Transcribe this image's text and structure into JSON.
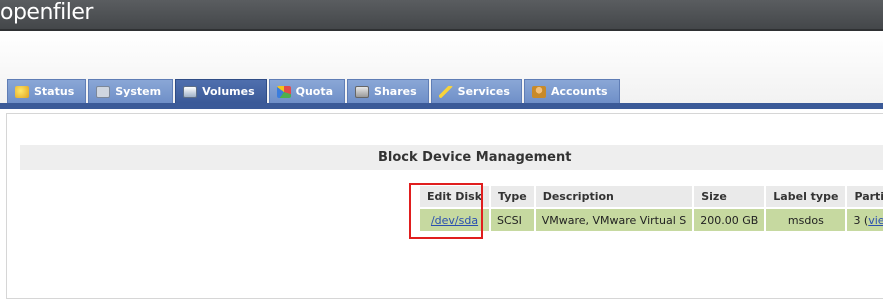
{
  "app": {
    "logo": "openfiler"
  },
  "tabs": [
    {
      "label": "Status",
      "icon": "status-icon",
      "active": false
    },
    {
      "label": "System",
      "icon": "system-icon",
      "active": false
    },
    {
      "label": "Volumes",
      "icon": "volumes-icon",
      "active": true
    },
    {
      "label": "Quota",
      "icon": "quota-icon",
      "active": false
    },
    {
      "label": "Shares",
      "icon": "shares-icon",
      "active": false
    },
    {
      "label": "Services",
      "icon": "services-icon",
      "active": false
    },
    {
      "label": "Accounts",
      "icon": "accounts-icon",
      "active": false
    }
  ],
  "section": {
    "title": "Block Device Management"
  },
  "table": {
    "headers": [
      "Edit Disk",
      "Type",
      "Description",
      "Size",
      "Label type",
      "Partitions"
    ],
    "rows": [
      {
        "edit_disk": "/dev/sda",
        "type": "SCSI",
        "description": "VMware, VMware Virtual S",
        "size": "200.00 GB",
        "label_type": "msdos",
        "partitions_count": "3 (",
        "partitions_link": "view",
        "partitions_close": ")"
      }
    ]
  },
  "colors": {
    "accent": "#3b5a98",
    "tab": "#7b98cf",
    "row": "#c6d9a0",
    "highlight": "#e01e1e"
  }
}
